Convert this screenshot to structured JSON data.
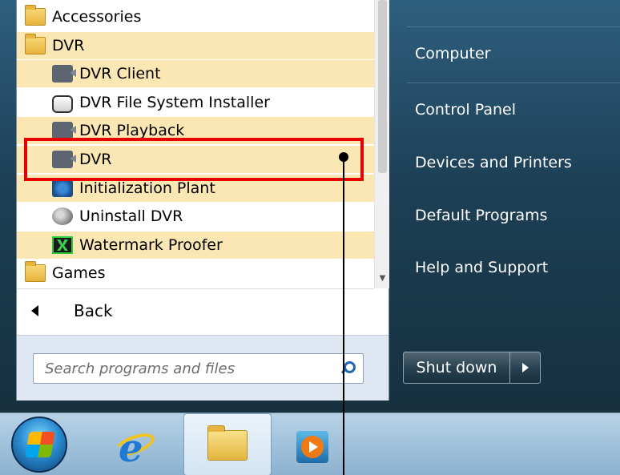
{
  "programs": {
    "items": [
      {
        "label": "Accessories",
        "icon": "folder-icon"
      },
      {
        "label": "DVR",
        "icon": "folder-icon"
      },
      {
        "label": "DVR Client",
        "icon": "camera-icon"
      },
      {
        "label": "DVR File System Installer",
        "icon": "drive-icon"
      },
      {
        "label": "DVR Playback",
        "icon": "camera-icon"
      },
      {
        "label": "DVR",
        "icon": "camera-icon"
      },
      {
        "label": "Initialization Plant",
        "icon": "plant-icon"
      },
      {
        "label": "Uninstall DVR",
        "icon": "uninstall-icon"
      },
      {
        "label": "Watermark Proofer",
        "icon": "watermark-icon"
      },
      {
        "label": "Games",
        "icon": "folder-icon"
      }
    ],
    "back_label": "Back"
  },
  "search": {
    "placeholder": "Search programs and files"
  },
  "right_pane": {
    "items": [
      "Computer",
      "Control Panel",
      "Devices and Printers",
      "Default Programs",
      "Help and Support"
    ]
  },
  "shutdown": {
    "label": "Shut down"
  },
  "taskbar": {
    "items": [
      "start-orb",
      "internet-explorer-icon",
      "windows-explorer-icon",
      "media-player-icon"
    ]
  },
  "colors": {
    "highlight": "#fbe7b4",
    "callout": "#e60000",
    "menu_dark": "#1d3f55"
  }
}
